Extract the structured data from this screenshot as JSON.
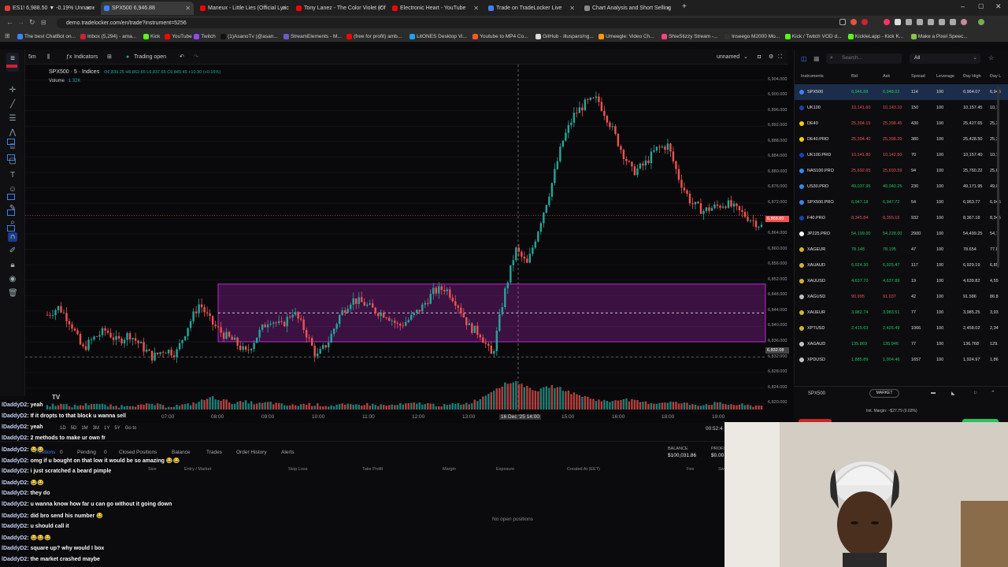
{
  "browser": {
    "tabs": [
      {
        "label": "ES1! 6,988.50 ▼ -0.19% Unnamed",
        "color": "#e53935"
      },
      {
        "label": "SPX500 6,946.88",
        "color": "#3b82f6",
        "active": true
      },
      {
        "label": "Maneux - Little Lies (Official Lyric",
        "color": "#ff0000"
      },
      {
        "label": "Tony Lanez - The Color Violet (Offic",
        "color": "#ff0000"
      },
      {
        "label": "Electronic Heart - YouTube",
        "color": "#ff0000"
      },
      {
        "label": "Trade on TradeLocker Live",
        "color": "#3b82f6"
      },
      {
        "label": "Chart Analysis and Short Selling",
        "color": "#888888"
      }
    ],
    "url": "demo.tradelocker.com/en/trade?instrument=5256",
    "bookmarks": [
      "The best ChatBot on...",
      "Inbox (5,294) - ama...",
      "Kick",
      "YouTube",
      "Twitch",
      "(1)AsanoTv (@asan...",
      "StreamElements - M...",
      "(free for profit) amb...",
      "LitONES Desktop Vi...",
      "Youtube to MP4 Co...",
      "GitHub - illusparo/ng...",
      "Umeegle: Video Ch...",
      "ShieStizzy Stream -...",
      "Inseego M2000 Mo...",
      "Kick / Twitch VOD d...",
      "KickleLapp - Kick K...",
      "Make a Pixel Speec..."
    ]
  },
  "chart_toolbar": {
    "timeframe": "5m",
    "indicators": "Indicators",
    "status": "Trading open",
    "layout_name": "unnamed"
  },
  "chart_header": {
    "symbol": "SPX500 · 5 · Indices",
    "ohlc": "O6,839.25 H6,862.65 L6,837.65 C6,849.45 +10.30 (+0.15%)",
    "volume_label": "Volume",
    "volume_value": "1.32K"
  },
  "chart_data": {
    "type": "candlestick",
    "title": "SPX500 · 5 · Indices",
    "xlabel": "",
    "ylabel": "",
    "x_ticks": [
      "07:00",
      "08:00",
      "09:00",
      "10:00",
      "11:00",
      "12:00",
      "13:00",
      "16 Dec '25  14:00",
      "15:00",
      "16:00",
      "18:00",
      "19:00"
    ],
    "y_ticks": [
      6904,
      6900,
      6896,
      6892,
      6888,
      6884,
      6880,
      6876,
      6872,
      6868,
      6864,
      6860,
      6856,
      6852,
      6848,
      6844,
      6840,
      6836,
      6832,
      6828,
      6824,
      6820
    ],
    "ylim": [
      6818,
      6908
    ],
    "current_price": 6868.8,
    "crosshair_price": 6832.08,
    "range_box": {
      "low": 6836,
      "high": 6851
    },
    "close_path": [
      6843,
      6845,
      6841,
      6834,
      6837,
      6839,
      6836,
      6838,
      6835,
      6832,
      6834,
      6833,
      6840,
      6846,
      6841,
      6838,
      6836,
      6833,
      6838,
      6842,
      6840,
      6844,
      6839,
      6832,
      6836,
      6843,
      6847,
      6846,
      6844,
      6843,
      6840,
      6842,
      6845,
      6849,
      6850,
      6846,
      6840,
      6838,
      6832,
      6848,
      6860,
      6856,
      6866,
      6876,
      6888,
      6895,
      6898,
      6899,
      6893,
      6886,
      6880,
      6882,
      6886,
      6887,
      6878,
      6872,
      6870,
      6871,
      6872,
      6870,
      6868,
      6866
    ],
    "volume_path": [
      3,
      5,
      2,
      4,
      6,
      3,
      2,
      4,
      3,
      5,
      2,
      3,
      4,
      8,
      14,
      10,
      6,
      8,
      5,
      7,
      4,
      3,
      5,
      4,
      3,
      4,
      3,
      5,
      4,
      3,
      4,
      5,
      6,
      4,
      3,
      5,
      6,
      12,
      22,
      30,
      34,
      26,
      22,
      28,
      24,
      18,
      14,
      10,
      8,
      12,
      9,
      7,
      6,
      8,
      6,
      5,
      4,
      6,
      5,
      4,
      3,
      3
    ]
  },
  "colors": {
    "up": "#26a69a",
    "down": "#ef5350",
    "accent": "#3b82f6",
    "box": "#c026d3"
  },
  "instruments": {
    "search_placeholder": "Search...",
    "filter": "All",
    "headers": [
      "Instruments",
      "Bid",
      "Ask",
      "Spread",
      "Leverage",
      "Day High",
      "Day L"
    ],
    "rows": [
      {
        "name": "SPX500",
        "bid": "6,946.88",
        "ask": "6,948.02",
        "spread": "114",
        "lev": "100",
        "high": "6,964.07",
        "low": "6,946"
      },
      {
        "name": "UK100",
        "bid": "10,141.60",
        "ask": "10,143.10",
        "spread": "150",
        "lev": "100",
        "high": "10,157.45",
        "low": "10,1"
      },
      {
        "name": "DE40",
        "bid": "25,394.15",
        "ask": "25,398.45",
        "spread": "430",
        "lev": "100",
        "high": "25,427.65",
        "low": "25,3"
      },
      {
        "name": "DE40.PRO",
        "bid": "25,394.40",
        "ask": "25,398.20",
        "spread": "380",
        "lev": "100",
        "high": "25,428.50",
        "low": "25,3"
      },
      {
        "name": "UK100.PRO",
        "bid": "10,141.80",
        "ask": "10,142.50",
        "spread": "70",
        "lev": "100",
        "high": "10,157.40",
        "low": "10,1"
      },
      {
        "name": "NAS100.PRO",
        "bid": "25,692.65",
        "ask": "25,693.59",
        "spread": "94",
        "lev": "100",
        "high": "25,760.22",
        "low": "25,6"
      },
      {
        "name": "US30.PRO",
        "bid": "49,037.95",
        "ask": "49,040.25",
        "spread": "230",
        "lev": "100",
        "high": "49,171.95",
        "low": "49,0"
      },
      {
        "name": "SPX500.PRO",
        "bid": "6,947.18",
        "ask": "6,947.72",
        "spread": "54",
        "lev": "100",
        "high": "6,963.77",
        "low": "6,946"
      },
      {
        "name": "F40.PRO",
        "bid": "8,345.84",
        "ask": "8,355.16",
        "spread": "932",
        "lev": "100",
        "high": "8,367.18",
        "low": "8,345"
      },
      {
        "name": "JP225.PRO",
        "bid": "54,199.00",
        "ask": "54,228.00",
        "spread": "2900",
        "lev": "100",
        "high": "54,499.25",
        "low": "54,1"
      },
      {
        "name": "XAGEUR",
        "bid": "78.148",
        "ask": "78.195",
        "spread": "47",
        "lev": "100",
        "high": "78.654",
        "low": "77.8"
      },
      {
        "name": "XAUAUD",
        "bid": "6,924.30",
        "ask": "6,925.47",
        "spread": "117",
        "lev": "100",
        "high": "6,929.19",
        "low": "6,85"
      },
      {
        "name": "XAUUSD",
        "bid": "4,637.70",
        "ask": "4,637.89",
        "spread": "19",
        "lev": "100",
        "high": "4,639.82",
        "low": "4,55"
      },
      {
        "name": "XAGUSD",
        "bid": "90.995",
        "ask": "91.037",
        "spread": "42",
        "lev": "100",
        "high": "91.586",
        "low": "86.8"
      },
      {
        "name": "XAUEUR",
        "bid": "3,982.74",
        "ask": "3,983.51",
        "spread": "77",
        "lev": "100",
        "high": "3,985.25",
        "low": "3,93"
      },
      {
        "name": "XPTUSD",
        "bid": "2,415.63",
        "ask": "2,426.49",
        "spread": "1066",
        "lev": "100",
        "high": "2,458.02",
        "low": "2,34"
      },
      {
        "name": "XAGAUD",
        "bid": "135.869",
        "ask": "135.946",
        "spread": "77",
        "lev": "100",
        "high": "136.768",
        "low": "129."
      },
      {
        "name": "XPDUSD",
        "bid": "1,885.89",
        "ask": "1,904.46",
        "spread": "1657",
        "lev": "100",
        "high": "1,924.97",
        "low": "1,86"
      }
    ]
  },
  "order_panel": {
    "symbol": "SPX500",
    "type": "MARKET",
    "margin_text": "Init. Margin: ~$27.79 (0.03%)"
  },
  "bottom": {
    "tabs": [
      "Positions",
      "Pending",
      "Closed Positions",
      "Balance",
      "Trades",
      "Order History",
      "Alerts"
    ],
    "positions_count": "0",
    "pending_count": "0",
    "columns": [
      "Size",
      "Entry / Market",
      "Stop Loss",
      "Take Profit",
      "Margin",
      "Exposure",
      "Created At (EET)",
      "Fee",
      "Sw"
    ],
    "empty_text": "No open positions",
    "balance_label": "BALANCE",
    "balance_value": "$100,031.86",
    "profit_label": "PROFIT",
    "profit_value": "$0.00",
    "timer": "00:52:4",
    "ranges": [
      "1D",
      "5D",
      "1M",
      "3M",
      "1Y",
      "5Y",
      "Go to"
    ]
  },
  "chat": [
    {
      "user": "lDaddyD2",
      "msg": "yeah"
    },
    {
      "user": "lDaddyD2",
      "msg": "If it dropts to that block u wanna sell"
    },
    {
      "user": "lDaddyD2",
      "msg": "yeah"
    },
    {
      "user": "lDaddyD2",
      "msg": "2 methods to make ur own fr"
    },
    {
      "user": "lDaddyD2",
      "msg": "😂😂"
    },
    {
      "user": "lDaddyD2",
      "msg": "omg if u bought on that low it would be so amazing 😂😂"
    },
    {
      "user": "lDaddyD2",
      "msg": "i just scratched a beard pimple"
    },
    {
      "user": "lDaddyD2",
      "msg": "😂😂"
    },
    {
      "user": "lDaddyD2",
      "msg": "they do"
    },
    {
      "user": "lDaddyD2",
      "msg": "u wanna know how far u can go without it going down"
    },
    {
      "user": "lDaddyD2",
      "msg": "did bro send his number 😂"
    },
    {
      "user": "lDaddyD2",
      "msg": "u should call it"
    },
    {
      "user": "lDaddyD2",
      "msg": "😂😂😂"
    },
    {
      "user": "lDaddyD2",
      "msg": "square up? why would I box"
    },
    {
      "user": "lDaddyD2",
      "msg": "the market crashed maybe"
    }
  ]
}
